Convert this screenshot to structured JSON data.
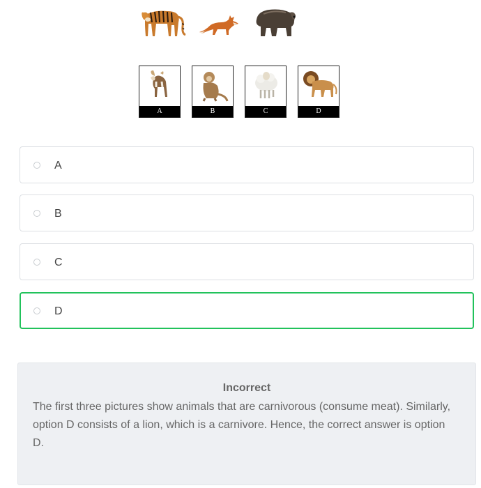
{
  "question": {
    "images": [
      {
        "icon": "tiger-icon"
      },
      {
        "icon": "fox-icon"
      },
      {
        "icon": "bear-icon"
      }
    ]
  },
  "option_images": [
    {
      "caption": "A",
      "icon": "goat-icon"
    },
    {
      "caption": "B",
      "icon": "monkey-icon"
    },
    {
      "caption": "C",
      "icon": "sheep-icon"
    },
    {
      "caption": "D",
      "icon": "lion-icon"
    }
  ],
  "choices": [
    {
      "label": "A",
      "state": "default"
    },
    {
      "label": "B",
      "state": "default"
    },
    {
      "label": "C",
      "state": "default"
    },
    {
      "label": "D",
      "state": "correct"
    }
  ],
  "feedback": {
    "title": "Incorrect",
    "text": "The first three pictures show animals that are carnivorous (consume meat). Similarly, option D consists of a lion, which is a carnivore. Hence, the correct answer is option D."
  },
  "colors": {
    "correct_border": "#21c25b",
    "feedback_bg": "#eef0f3",
    "caption_bg": "#000000"
  }
}
